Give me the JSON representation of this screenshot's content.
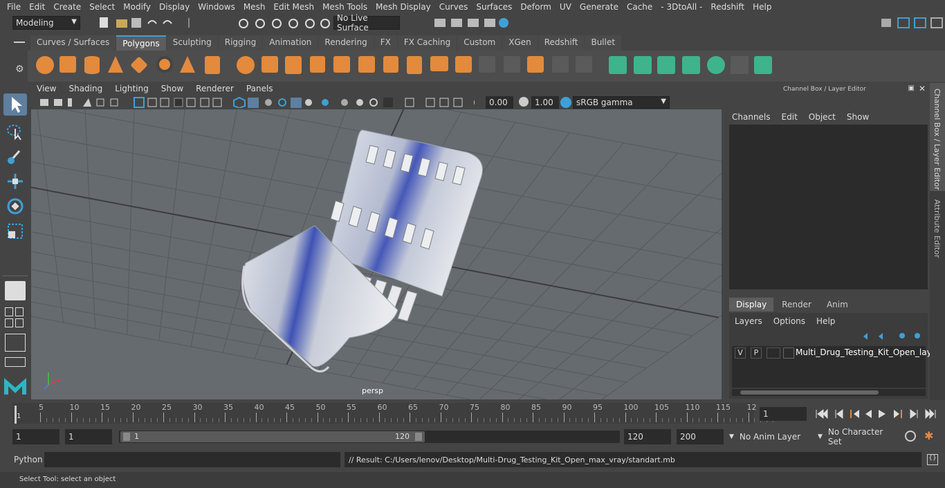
{
  "menu": [
    "File",
    "Edit",
    "Create",
    "Select",
    "Modify",
    "Display",
    "Windows",
    "Mesh",
    "Edit Mesh",
    "Mesh Tools",
    "Mesh Display",
    "Curves",
    "Surfaces",
    "Deform",
    "UV",
    "Generate",
    "Cache",
    "- 3DtoAll -",
    "Redshift",
    "Help"
  ],
  "status": {
    "mode": "Modeling",
    "live_surface": "No Live Surface"
  },
  "shelf_tabs": [
    {
      "label": "Curves / Surfaces",
      "active": false
    },
    {
      "label": "Polygons",
      "active": true
    },
    {
      "label": "Sculpting",
      "active": false
    },
    {
      "label": "Rigging",
      "active": false
    },
    {
      "label": "Animation",
      "active": false
    },
    {
      "label": "Rendering",
      "active": false
    },
    {
      "label": "FX",
      "active": false
    },
    {
      "label": "FX Caching",
      "active": false
    },
    {
      "label": "Custom",
      "active": false
    },
    {
      "label": "XGen",
      "active": false
    },
    {
      "label": "Redshift",
      "active": false
    },
    {
      "label": "Bullet",
      "active": false
    }
  ],
  "viewport": {
    "menu": [
      "View",
      "Shading",
      "Lighting",
      "Show",
      "Renderer",
      "Panels"
    ],
    "exposure": "0.00",
    "gamma": "1.00",
    "colorspace": "sRGB gamma",
    "camera_label": "persp"
  },
  "channel_box": {
    "title": "Channel Box / Layer Editor",
    "menu": [
      "Channels",
      "Edit",
      "Object",
      "Show"
    ],
    "layer_tabs": [
      {
        "label": "Display",
        "active": true
      },
      {
        "label": "Render",
        "active": false
      },
      {
        "label": "Anim",
        "active": false
      }
    ],
    "layer_menu": [
      "Layers",
      "Options",
      "Help"
    ],
    "layer": {
      "v": "V",
      "p": "P",
      "name": "Multi_Drug_Testing_Kit_Open_layer"
    }
  },
  "side_tabs": {
    "channel_box": "Channel Box / Layer Editor",
    "attribute_editor": "Attribute Editor"
  },
  "timeline": {
    "ticks": [
      "5",
      "10",
      "15",
      "20",
      "25",
      "30",
      "35",
      "40",
      "45",
      "50",
      "55",
      "60",
      "65",
      "70",
      "75",
      "80",
      "85",
      "90",
      "95",
      "100",
      "105",
      "110",
      "115",
      "12"
    ],
    "start_marker": "1",
    "current_frame": "1"
  },
  "range": {
    "start": "1",
    "playback_start": "1",
    "slider_start": "1",
    "slider_end": "120",
    "playback_end": "120",
    "end": "200",
    "anim_layer": "No Anim Layer",
    "character_set": "No Character Set"
  },
  "command": {
    "lang": "Python",
    "result": "// Result: C:/Users/lenov/Desktop/Multi-Drug_Testing_Kit_Open_max_vray/standart.mb"
  },
  "help": "Select Tool: select an object"
}
